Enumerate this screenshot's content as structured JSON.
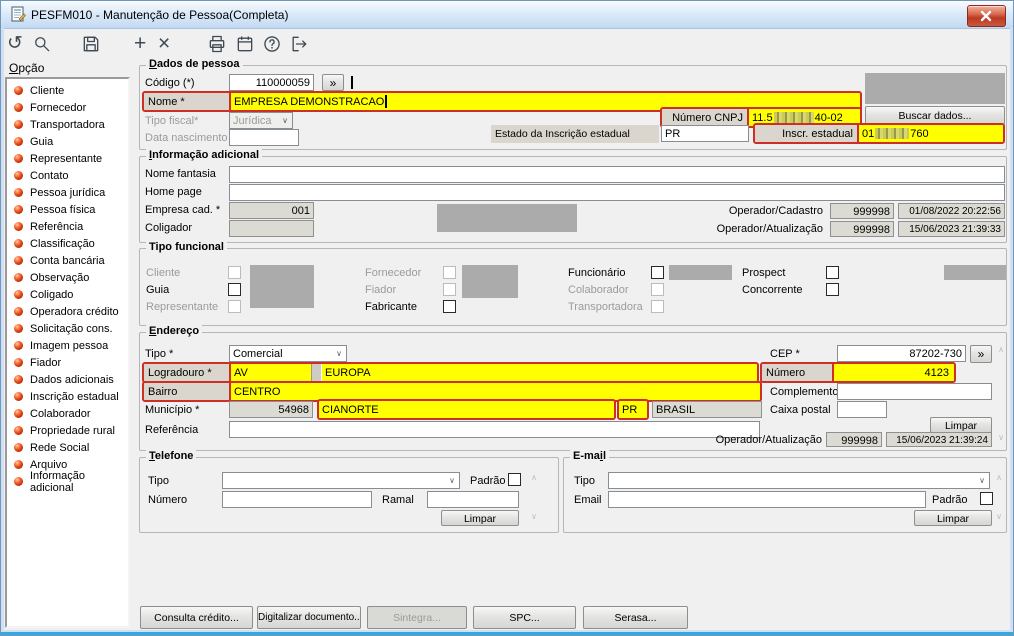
{
  "window": {
    "title": "PESFM010 - Manutenção de Pessoa(Completa)"
  },
  "toolbar": {
    "icons": [
      "undo",
      "search",
      "save",
      "add",
      "delete",
      "print",
      "calendar",
      "help",
      "exit"
    ]
  },
  "icons": {
    "jump": "»",
    "chevron": "∨",
    "scroll_up": "∧",
    "scroll_down": "∨",
    "help": "?",
    "undo": "↺",
    "add": "+",
    "delete": "×"
  },
  "sidebar": {
    "header_accel": "O",
    "header_rest": "pção",
    "items": [
      "Cliente",
      "Fornecedor",
      "Transportadora",
      "Guia",
      "Representante",
      "Contato",
      "Pessoa jurídica",
      "Pessoa física",
      "Referência",
      "Classificação",
      "Conta bancária",
      "Observação",
      "Coligado",
      "Operadora crédito",
      "Solicitação cons.",
      "Imagem pessoa",
      "Fiador",
      "Dados adicionais",
      "Inscrição estadual",
      "Colaborador",
      "Propriedade rural",
      "Rede Social",
      "Arquivo",
      "Informação adicional"
    ]
  },
  "dados": {
    "title_accel": "D",
    "title_rest": "ados de pessoa",
    "codigo_label": "Código (*)",
    "codigo": "110000059",
    "nome_label": "Nome *",
    "nome": "EMPRESA DEMONSTRACAO",
    "tipo_fiscal_label": "Tipo fiscal*",
    "tipo_fiscal": "Jurídica",
    "data_nascimento_label": "Data nascimento",
    "cnpj_label": "Número CNPJ",
    "cnpj_prefix": "11.5",
    "cnpj_suffix": "40-02",
    "buscar_dados": "Buscar dados...",
    "estado_ie_label": "Estado da Inscrição estadual",
    "estado_ie": "PR",
    "ie_label": "Inscr. estadual",
    "ie_prefix": "01",
    "ie_suffix": "760"
  },
  "info": {
    "title_accel": "I",
    "title_rest": "nformação adicional",
    "nome_fantasia_label": "Nome fantasia",
    "home_page_label": "Home page",
    "empresa_label": "Empresa cad. *",
    "empresa": "001",
    "coligador_label": "Coligador",
    "op_cadastro_label": "Operador/Cadastro",
    "op_cadastro_id": "999998",
    "op_cadastro_data": "01/08/2022 20:22:56",
    "op_atualizacao_label": "Operador/Atualização",
    "op_atualizacao_id": "999998",
    "op_atualizacao_data": "15/06/2023 21:39:33"
  },
  "funcional": {
    "title": "Tipo funcional",
    "items": [
      "Cliente",
      "Guia",
      "Representante",
      "Fornecedor",
      "Fiador",
      "Fabricante",
      "Funcionário",
      "Colaborador",
      "Transportadora",
      "Prospect",
      "Concorrente"
    ]
  },
  "endereco": {
    "title_accel": "E",
    "title_rest": "ndereço",
    "tipo_label": "Tipo *",
    "tipo": "Comercial",
    "logradouro_label": "Logradouro *",
    "logradouro_tipo": "AV",
    "logradouro": "EUROPA",
    "bairro_label": "Bairro",
    "bairro": "CENTRO",
    "municipio_label": "Município *",
    "municipio_cod": "54968",
    "municipio": "CIANORTE",
    "uf": "PR",
    "pais": "BRASIL",
    "referencia_label": "Referência",
    "cep_label": "CEP *",
    "cep": "87202-730",
    "numero_label": "Número",
    "numero": "4123",
    "complemento_label": "Complemento",
    "caixa_postal_label": "Caixa postal",
    "limpar": "Limpar",
    "op_label": "Operador/Atualização",
    "op_id": "999998",
    "op_data": "15/06/2023 21:39:24"
  },
  "telefone": {
    "title_accel": "T",
    "title_rest": "elefone",
    "tipo_label": "Tipo",
    "numero_label": "Número",
    "ramal_label": "Ramal",
    "padrao_label": "Padrão",
    "limpar": "Limpar"
  },
  "email": {
    "title_prefix": "E-ma",
    "title_accel": "i",
    "title_rest": "l",
    "tipo_label": "Tipo",
    "email_label": "Email",
    "padrao_label": "Padrão",
    "limpar": "Limpar"
  },
  "footer": {
    "buttons": [
      "Consulta crédito...",
      "Digitalizar documento...",
      "Sintegra...",
      "SPC...",
      "Serasa..."
    ]
  }
}
